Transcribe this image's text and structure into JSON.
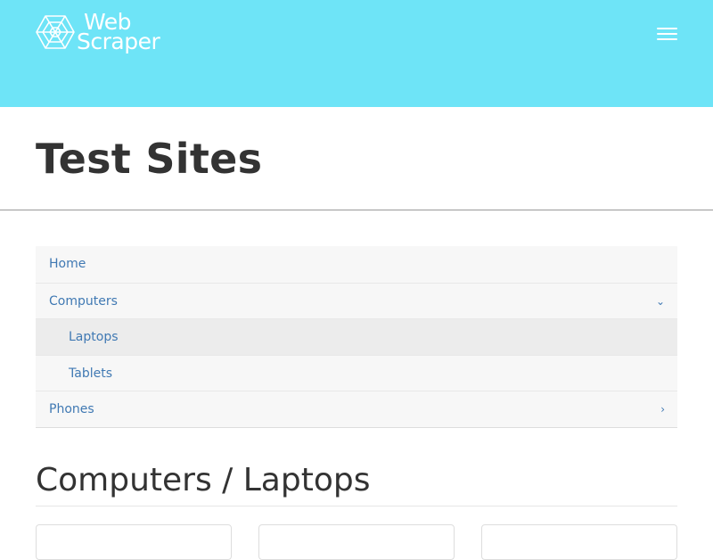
{
  "header": {
    "logo": {
      "line1": "Web",
      "line2": "Scraper",
      "icon": "spider-web-icon"
    },
    "menu_icon": "hamburger-menu-icon",
    "background_color": "#6ee4f7"
  },
  "page_title": "Test Sites",
  "sidebar": {
    "items": [
      {
        "label": "Home",
        "level": 0
      },
      {
        "label": "Computers",
        "level": 0,
        "chevron": "⌄",
        "expanded": true
      },
      {
        "label": "Laptops",
        "level": 1,
        "active": true
      },
      {
        "label": "Tablets",
        "level": 1
      },
      {
        "label": "Phones",
        "level": 0,
        "chevron": "›",
        "expanded": false
      }
    ]
  },
  "category_title": "Computers / Laptops",
  "colors": {
    "link": "#4079b3",
    "heading": "#333333",
    "nav_background": "#f7f7f7",
    "nav_active_background": "#ececec"
  }
}
